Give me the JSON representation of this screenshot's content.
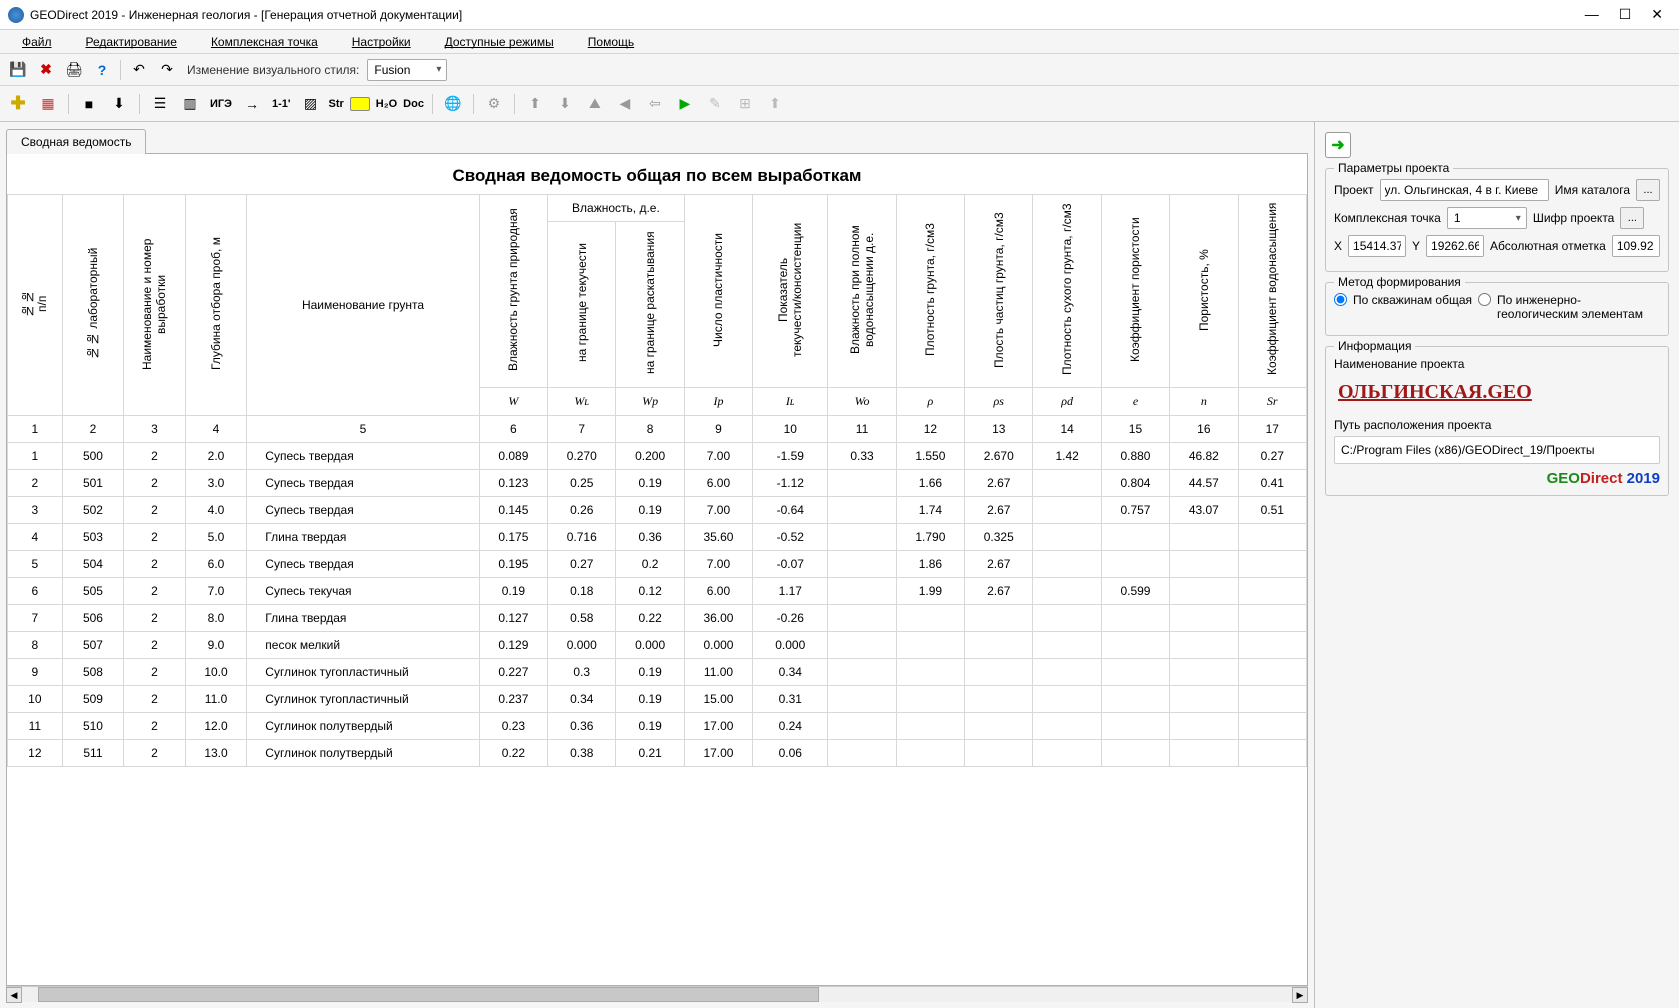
{
  "title": "GEODirect 2019 - Инженерная геология - [Генерация отчетной документации]",
  "menu": {
    "file": "Файл",
    "edit": "Редактирование",
    "complex": "Комплексная точка",
    "settings": "Настройки",
    "modes": "Доступные режимы",
    "help": "Помощь"
  },
  "toolbar": {
    "style_label": "Изменение визуального стиля:",
    "style_value": "Fusion"
  },
  "tb2": {
    "ige": "ИГЭ",
    "oneone": "1-1'",
    "str": "Str",
    "h2o": "H₂O",
    "doc": "Doc"
  },
  "tab": "Сводная ведомость",
  "table_title": "Сводная ведомость общая по всем выработкам",
  "headers": {
    "npp": "№№\nп/п",
    "nlab": "№№\nлабораторный",
    "name_num": "Наименование и номер\nвыработки",
    "depth": "Глубина отбора проб, м",
    "soil_name": "Наименование грунта",
    "moisture_group": "Влажность, д.е.",
    "w_nat": "Влажность грунта природная",
    "w_l": "на границе текучести",
    "w_p": "на границе раскатывания",
    "ip": "Число пластичности",
    "il": "Показатель\nтекучести/консистенции",
    "wo": "Влажность при полном\nводонасыщении д.е.",
    "rho": "Плотность грунта, г/см3",
    "rhos": "Плость частиц грунта, г/см3",
    "rhod": "Плотность сухого грунта, г/см3",
    "e": "Коэффициент пористости",
    "n": "Пористость, %",
    "sr": "Коэффициент водонасыщения"
  },
  "symbols": [
    "W",
    "Wʟ",
    "Wp",
    "Ip",
    "Iʟ",
    "Wo",
    "ρ",
    "ρs",
    "ρd",
    "e",
    "n",
    "Sr"
  ],
  "col_nums": [
    "1",
    "2",
    "3",
    "4",
    "5",
    "6",
    "7",
    "8",
    "9",
    "10",
    "11",
    "12",
    "13",
    "14",
    "15",
    "16",
    "17"
  ],
  "rows": [
    [
      "1",
      "500",
      "2",
      "2.0",
      "Супесь твердая",
      "0.089",
      "0.270",
      "0.200",
      "7.00",
      "-1.59",
      "0.33",
      "1.550",
      "2.670",
      "1.42",
      "0.880",
      "46.82",
      "0.27"
    ],
    [
      "2",
      "501",
      "2",
      "3.0",
      "Супесь твердая",
      "0.123",
      "0.25",
      "0.19",
      "6.00",
      "-1.12",
      "",
      "1.66",
      "2.67",
      "",
      "0.804",
      "44.57",
      "0.41"
    ],
    [
      "3",
      "502",
      "2",
      "4.0",
      "Супесь твердая",
      "0.145",
      "0.26",
      "0.19",
      "7.00",
      "-0.64",
      "",
      "1.74",
      "2.67",
      "",
      "0.757",
      "43.07",
      "0.51"
    ],
    [
      "4",
      "503",
      "2",
      "5.0",
      "Глина твердая",
      "0.175",
      "0.716",
      "0.36",
      "35.60",
      "-0.52",
      "",
      "1.790",
      "0.325",
      "",
      "",
      "",
      ""
    ],
    [
      "5",
      "504",
      "2",
      "6.0",
      "Супесь твердая",
      "0.195",
      "0.27",
      "0.2",
      "7.00",
      "-0.07",
      "",
      "1.86",
      "2.67",
      "",
      "",
      "",
      ""
    ],
    [
      "6",
      "505",
      "2",
      "7.0",
      "Супесь текучая",
      "0.19",
      "0.18",
      "0.12",
      "6.00",
      "1.17",
      "",
      "1.99",
      "2.67",
      "",
      "0.599",
      "",
      ""
    ],
    [
      "7",
      "506",
      "2",
      "8.0",
      "Глина твердая",
      "0.127",
      "0.58",
      "0.22",
      "36.00",
      "-0.26",
      "",
      "",
      "",
      "",
      "",
      "",
      ""
    ],
    [
      "8",
      "507",
      "2",
      "9.0",
      "песок мелкий",
      "0.129",
      "0.000",
      "0.000",
      "0.000",
      "0.000",
      "",
      "",
      "",
      "",
      "",
      "",
      ""
    ],
    [
      "9",
      "508",
      "2",
      "10.0",
      "Суглинок тугопластичный",
      "0.227",
      "0.3",
      "0.19",
      "11.00",
      "0.34",
      "",
      "",
      "",
      "",
      "",
      "",
      ""
    ],
    [
      "10",
      "509",
      "2",
      "11.0",
      "Суглинок тугопластичный",
      "0.237",
      "0.34",
      "0.19",
      "15.00",
      "0.31",
      "",
      "",
      "",
      "",
      "",
      "",
      ""
    ],
    [
      "11",
      "510",
      "2",
      "12.0",
      "Суглинок полутвердый",
      "0.23",
      "0.36",
      "0.19",
      "17.00",
      "0.24",
      "",
      "",
      "",
      "",
      "",
      "",
      ""
    ],
    [
      "12",
      "511",
      "2",
      "13.0",
      "Суглинок полутвердый",
      "0.22",
      "0.38",
      "0.21",
      "17.00",
      "0.06",
      "",
      "",
      "",
      "",
      "",
      "",
      ""
    ]
  ],
  "right": {
    "params_title": "Параметры проекта",
    "project_label": "Проект",
    "project_value": "ул. Ольгинская, 4 в г. Киеве",
    "catalog_label": "Имя каталога",
    "complex_label": "Комплексная точка",
    "complex_value": "1",
    "cipher_label": "Шифр проекта",
    "x_label": "X",
    "x_val": "15414.37",
    "y_label": "Y",
    "y_val": "19262.66",
    "abs_label": "Абсолютная отметка",
    "abs_val": "109.92",
    "method_title": "Метод формирования",
    "radio1": "По скважинам общая",
    "radio2": "По инженерно-геологическим элементам",
    "info_title": "Информация",
    "name_label": "Наименование проекта",
    "proj_big": "ОЛЬГИНСКАЯ.GEO",
    "path_label": "Путь расположения проекта",
    "path_val": "C:/Program Files (x86)/GEODirect_19/Проекты",
    "brand_geo": "GEO",
    "brand_direct": "Direct ",
    "brand_year": "2019"
  }
}
